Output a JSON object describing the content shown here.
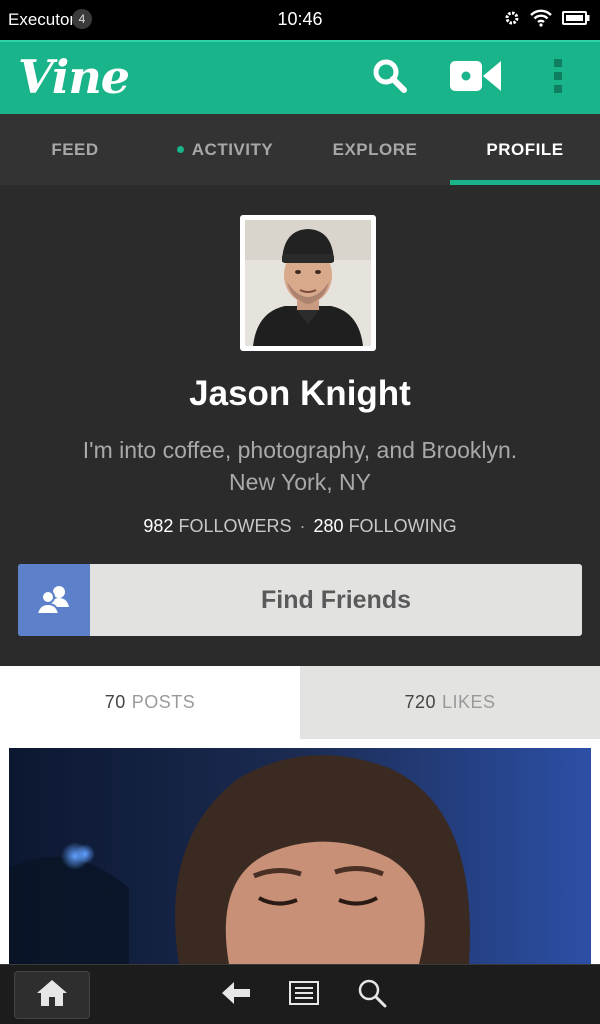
{
  "status_bar": {
    "app_name": "Executor",
    "notification_count": "4",
    "time": "10:46",
    "icons": [
      "gear-icon",
      "wifi-icon",
      "battery-icon"
    ]
  },
  "app_bar": {
    "logo": "Vine",
    "actions": [
      "search-icon",
      "video-camera-icon",
      "overflow-menu-icon"
    ],
    "accent_color": "#19b48a"
  },
  "tabs": [
    {
      "label": "FEED",
      "active": false
    },
    {
      "label": "ACTIVITY",
      "active": false,
      "has_dot": true
    },
    {
      "label": "EXPLORE",
      "active": false
    },
    {
      "label": "PROFILE",
      "active": true
    }
  ],
  "profile": {
    "name": "Jason Knight",
    "bio_line1": "I'm into coffee, photography, and Brooklyn.",
    "bio_line2": "New York, NY",
    "followers_count": "982",
    "followers_label": "FOLLOWERS",
    "separator": "·",
    "following_count": "280",
    "following_label": "FOLLOWING"
  },
  "find_friends": {
    "label": "Find Friends",
    "icon": "add-friends-icon",
    "icon_bg": "#5c80c9"
  },
  "subtabs": {
    "posts_count": "70",
    "posts_label": "POSTS",
    "likes_count": "720",
    "likes_label": "LIKES"
  },
  "bottom_nav": [
    "home-icon",
    "back-icon",
    "menu-icon",
    "search-icon"
  ]
}
